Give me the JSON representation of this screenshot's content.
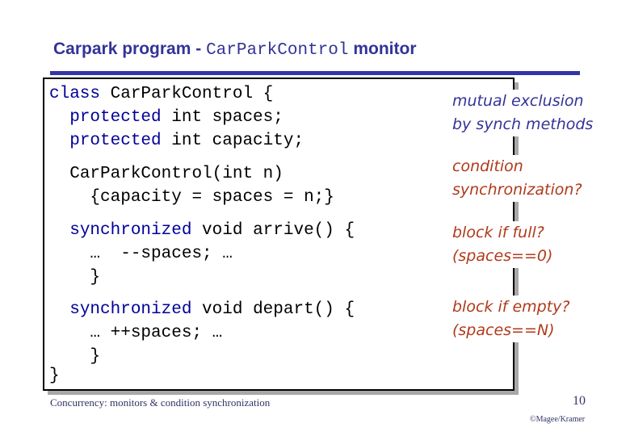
{
  "slide": {
    "title": {
      "prefix": "Carpark program - ",
      "code": "CarParkControl",
      "suffix": " monitor"
    },
    "code_lines": [
      {
        "kw": "class",
        "rest": " CarParkControl {"
      },
      {
        "indent": "  ",
        "kw": "protected",
        "rest": " int spaces;"
      },
      {
        "indent": "  ",
        "kw": "protected",
        "rest": " int capacity;"
      },
      {
        "indent": "  ",
        "kw": "",
        "rest": "CarParkControl(int n)"
      },
      {
        "indent": "    ",
        "kw": "",
        "rest": "{capacity = spaces = n;}"
      },
      {
        "indent": "  ",
        "kw": "synchronized",
        "rest": " void arrive() {"
      },
      {
        "indent": "    ",
        "kw": "",
        "rest": "…  --spaces; …"
      },
      {
        "indent": "    ",
        "kw": "",
        "rest": "}"
      },
      {
        "indent": "  ",
        "kw": "synchronized",
        "rest": " void depart() {"
      },
      {
        "indent": "    ",
        "kw": "",
        "rest": "… ++spaces; …"
      },
      {
        "indent": "    ",
        "kw": "",
        "rest": "}"
      },
      {
        "indent": "",
        "kw": "",
        "rest": "}"
      }
    ],
    "notes": [
      {
        "line1": "mutual exclusion",
        "line2": "by synch methods",
        "color": "#333399"
      },
      {
        "line1": "condition",
        "line2": "synchronization?",
        "color": "#b03a1a"
      },
      {
        "line1": "block if full?",
        "line2": "(spaces==0)",
        "color": "#b03a1a"
      },
      {
        "line1": "block if empty?",
        "line2": "(spaces==N)",
        "color": "#b03a1a"
      }
    ],
    "footer": {
      "caption": "Concurrency: monitors & condition synchronization",
      "page_number": "10",
      "copyright": "©Magee/Kramer"
    },
    "colors": {
      "title": "#333399",
      "rule": "#3333aa",
      "keyword": "#000099",
      "note_blue": "#333399",
      "note_rust": "#b03a1a"
    }
  }
}
